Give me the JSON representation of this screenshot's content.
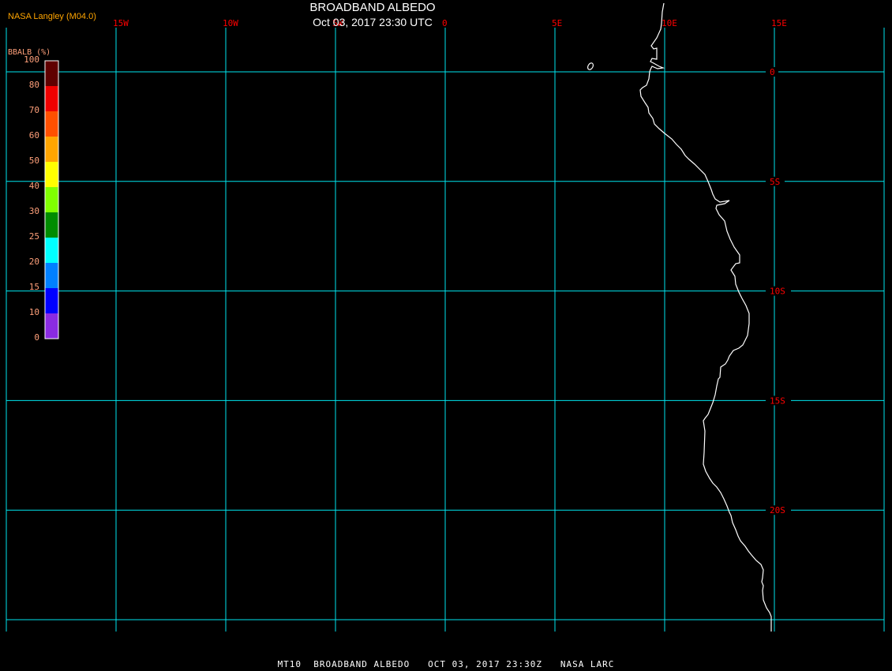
{
  "header": {
    "title": "BROADBAND ALBEDO",
    "datetime": "Oct 03, 2017 23:30 UTC",
    "credit": "NASA Langley (M04.0)"
  },
  "legend": {
    "title": "BBALB (%)",
    "labels": [
      "100",
      "80",
      "70",
      "60",
      "50",
      "40",
      "30",
      "25",
      "20",
      "15",
      "10",
      "0"
    ],
    "colors": [
      "#600000",
      "#f00000",
      "#ff5000",
      "#ffa500",
      "#ffff00",
      "#80ff00",
      "#008c00",
      "#00ffff",
      "#0080ff",
      "#0000ff",
      "#8a2be2"
    ]
  },
  "grid": {
    "color": "#00e5ee",
    "label_color": "#ff0000",
    "longitudes": [
      {
        "value": -20,
        "label": ""
      },
      {
        "value": -15,
        "label": "15W"
      },
      {
        "value": -10,
        "label": "10W"
      },
      {
        "value": -5,
        "label": "5W"
      },
      {
        "value": 0,
        "label": "0"
      },
      {
        "value": 5,
        "label": "5E"
      },
      {
        "value": 10,
        "label": "10E"
      },
      {
        "value": 15,
        "label": "15E"
      },
      {
        "value": 20,
        "label": ""
      }
    ],
    "latitudes": [
      {
        "value": 0,
        "label": "0"
      },
      {
        "value": -5,
        "label": "5S"
      },
      {
        "value": -10,
        "label": "10S"
      },
      {
        "value": -15,
        "label": "15S"
      },
      {
        "value": -20,
        "label": "20S"
      },
      {
        "value": -25,
        "label": ""
      }
    ]
  },
  "coastline_color": "#ffffff",
  "footer": "MT10  BROADBAND ALBEDO   OCT 03, 2017 23:30Z   NASA LARC"
}
